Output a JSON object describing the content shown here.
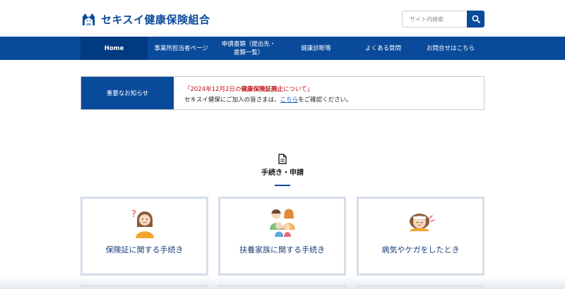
{
  "header": {
    "brand": "セキスイ健康保険組合",
    "search_placeholder": "サイト内検索",
    "icons": {
      "logo": "cat-house-logo-icon",
      "search": "search-icon"
    }
  },
  "nav": {
    "items": [
      {
        "label": "Home"
      },
      {
        "label": "事業所担当者ページ"
      },
      {
        "label_line1": "申請書類（提出先・",
        "label_line2": "書類一覧）"
      },
      {
        "label": "健康診断等"
      },
      {
        "label": "よくある質問"
      },
      {
        "label": "お問合せはこちら"
      }
    ]
  },
  "notice": {
    "label": "重要なお知らせ",
    "line1_pre": "「2024年12月2日の",
    "line1_strong": "健康保険証廃止",
    "line1_post": "について」",
    "line2_pre": "セキスイ健保にご加入の皆さまは、",
    "line2_link": "こちら",
    "line2_post": "をご確認ください。"
  },
  "section": {
    "title": "手続き・申請",
    "icon": "document-icon"
  },
  "cards": [
    {
      "label": "保険証に関する手続き",
      "icon": "woman-question-illustration"
    },
    {
      "label": "扶養家族に関する手続き",
      "icon": "family-illustration"
    },
    {
      "label": "病気やケガをしたとき",
      "icon": "sick-person-illustration"
    }
  ],
  "colors": {
    "brand_blue": "#0a4a9b",
    "nav_active": "#003a80",
    "notice_red": "#c0141b",
    "card_border": "#d5deea",
    "card_text": "#1d3f7a"
  }
}
